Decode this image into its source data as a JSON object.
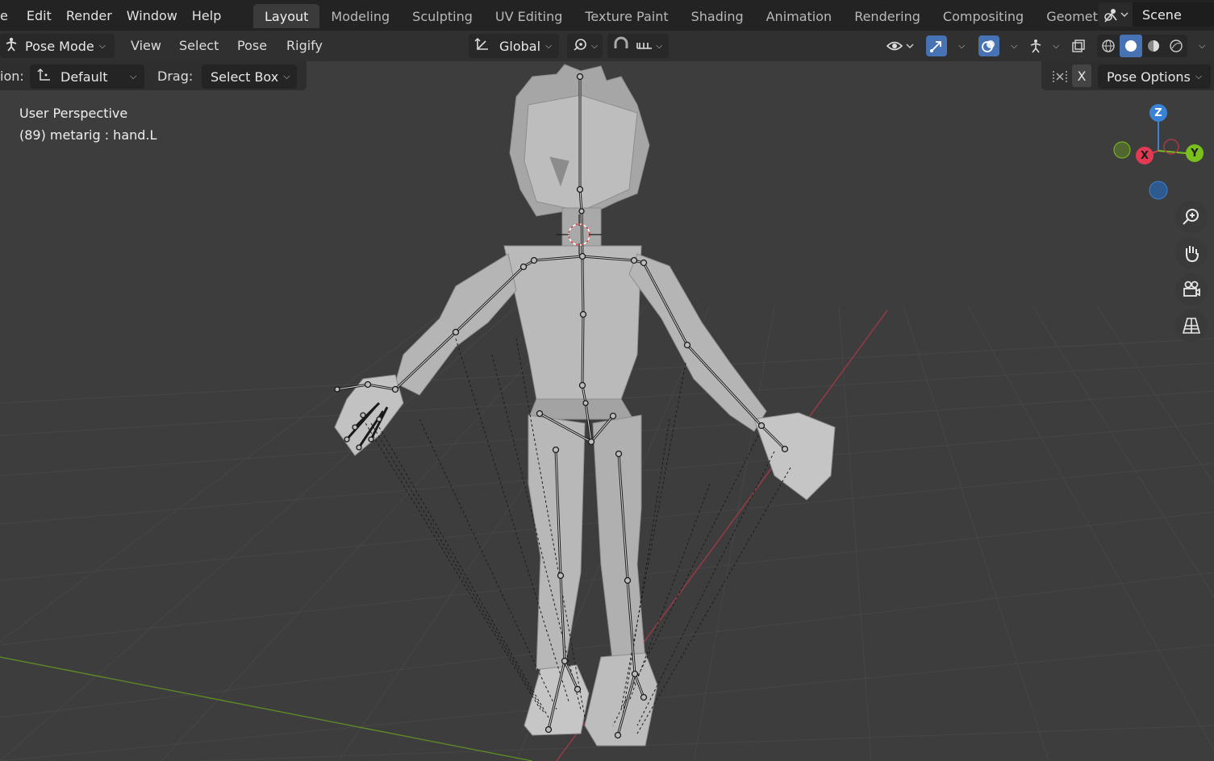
{
  "menu": [
    "e",
    "Edit",
    "Render",
    "Window",
    "Help"
  ],
  "workspaces": [
    "Layout",
    "Modeling",
    "Sculpting",
    "UV Editing",
    "Texture Paint",
    "Shading",
    "Animation",
    "Rendering",
    "Compositing",
    "Geomet"
  ],
  "active_workspace": "Layout",
  "scene": {
    "name": "Scene",
    "icon": "scene-icon"
  },
  "header": {
    "mode": "Pose Mode",
    "menus": [
      "View",
      "Select",
      "Pose",
      "Rigify"
    ],
    "orientation": "Global"
  },
  "tool_settings": {
    "orientation_label": "ion:",
    "orientation_value": "Default",
    "drag_label": "Drag:",
    "drag_value": "Select Box",
    "mirror_x": "X",
    "pose_options": "Pose Options"
  },
  "viewport": {
    "view_name": "User Perspective",
    "active_object": "(89) metarig : hand.L"
  },
  "gizmo": {
    "z": "Z",
    "y": "Y",
    "x": "X"
  },
  "colors": {
    "accent": "#4772b3",
    "axis_x": "#e23a53",
    "axis_y": "#7bbf1f",
    "axis_z": "#3a82d6",
    "grid": "#474747",
    "mesh": "#b2b2b2"
  }
}
